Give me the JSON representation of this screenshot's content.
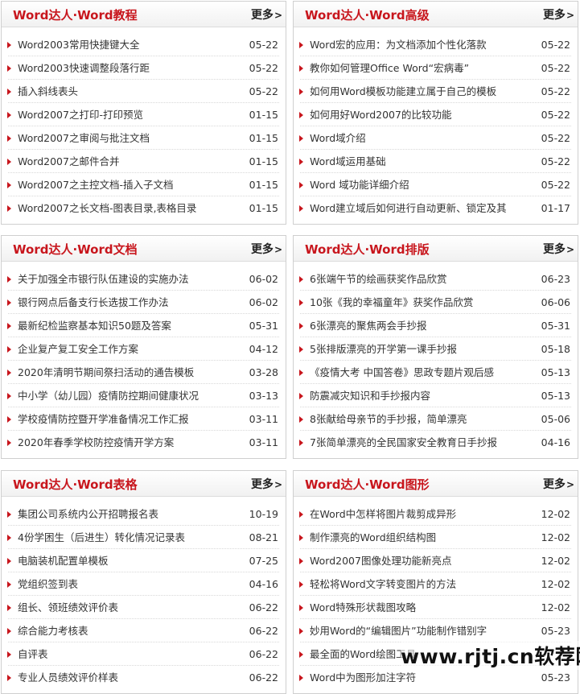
{
  "panels": [
    {
      "title": "Word达人·Word教程",
      "more": "更多",
      "items": [
        {
          "text": "Word2003常用快捷键大全",
          "date": "05-22"
        },
        {
          "text": "Word2003快速调整段落行距",
          "date": "05-22"
        },
        {
          "text": "插入斜线表头",
          "date": "05-22"
        },
        {
          "text": "Word2007之打印-打印预览",
          "date": "01-15"
        },
        {
          "text": "Word2007之审阅与批注文档",
          "date": "01-15"
        },
        {
          "text": "Word2007之邮件合并",
          "date": "01-15"
        },
        {
          "text": "Word2007之主控文档-插入子文档",
          "date": "01-15"
        },
        {
          "text": "Word2007之长文档-图表目录,表格目录",
          "date": "01-15"
        }
      ]
    },
    {
      "title": "Word达人·Word高级",
      "more": "更多",
      "items": [
        {
          "text": "Word宏的应用：为文档添加个性化落款",
          "date": "05-22"
        },
        {
          "text": "教你如何管理Office Word“宏病毒”",
          "date": "05-22"
        },
        {
          "text": "如何用Word模板功能建立属于自己的模板",
          "date": "05-22"
        },
        {
          "text": "如何用好Word2007的比较功能",
          "date": "05-22"
        },
        {
          "text": "Word域介绍",
          "date": "05-22"
        },
        {
          "text": "Word域运用基础",
          "date": "05-22"
        },
        {
          "text": "Word 域功能详细介绍",
          "date": "05-22"
        },
        {
          "text": "Word建立域后如何进行自动更新、锁定及其",
          "date": "01-17"
        }
      ]
    },
    {
      "title": "Word达人·Word文档",
      "more": "更多",
      "items": [
        {
          "text": "关于加强全市银行队伍建设的实施办法",
          "date": "06-02"
        },
        {
          "text": "银行网点后备支行长选拔工作办法",
          "date": "06-02"
        },
        {
          "text": "最新纪检监察基本知识50题及答案",
          "date": "05-31"
        },
        {
          "text": "企业复产复工安全工作方案",
          "date": "04-12"
        },
        {
          "text": "2020年清明节期间祭扫活动的通告模板",
          "date": "03-28"
        },
        {
          "text": "中小学（幼儿园）疫情防控期间健康状况",
          "date": "03-13"
        },
        {
          "text": "学校疫情防控暨开学准备情况工作汇报",
          "date": "03-11"
        },
        {
          "text": "2020年春季学校防控疫情开学方案",
          "date": "03-11"
        }
      ]
    },
    {
      "title": "Word达人·Word排版",
      "more": "更多",
      "items": [
        {
          "text": "6张端午节的绘画获奖作品欣赏",
          "date": "06-23"
        },
        {
          "text": "10张《我的幸福童年》获奖作品欣赏",
          "date": "06-06"
        },
        {
          "text": "6张漂亮的聚焦两会手抄报",
          "date": "05-31"
        },
        {
          "text": "5张排版漂亮的开学第一课手抄报",
          "date": "05-18"
        },
        {
          "text": "《疫情大考 中国答卷》思政专题片观后感",
          "date": "05-13"
        },
        {
          "text": "防震减灾知识和手抄报内容",
          "date": "05-13"
        },
        {
          "text": "8张献给母亲节的手抄报，简单漂亮",
          "date": "05-06"
        },
        {
          "text": "7张简单漂亮的全民国家安全教育日手抄报",
          "date": "04-16"
        }
      ]
    },
    {
      "title": "Word达人·Word表格",
      "more": "更多",
      "items": [
        {
          "text": "集团公司系统内公开招聘报名表",
          "date": "10-19"
        },
        {
          "text": "4份学困生（后进生）转化情况记录表",
          "date": "08-21"
        },
        {
          "text": "电脑装机配置单模板",
          "date": "07-25"
        },
        {
          "text": "党组织签到表",
          "date": "04-16"
        },
        {
          "text": "组长、领班绩效评价表",
          "date": "06-22"
        },
        {
          "text": "综合能力考核表",
          "date": "06-22"
        },
        {
          "text": "自评表",
          "date": "06-22"
        },
        {
          "text": "专业人员绩效评价样表",
          "date": "06-22"
        }
      ]
    },
    {
      "title": "Word达人·Word图形",
      "more": "更多",
      "items": [
        {
          "text": "在Word中怎样将图片裁剪成异形",
          "date": "12-02"
        },
        {
          "text": "制作漂亮的Word组织结构图",
          "date": "12-02"
        },
        {
          "text": "Word2007图像处理功能新亮点",
          "date": "12-02"
        },
        {
          "text": "轻松将Word文字转变图片的方法",
          "date": "12-02"
        },
        {
          "text": "Word特殊形状裁图攻略",
          "date": "12-02"
        },
        {
          "text": "妙用Word的“编辑图片”功能制作错别字",
          "date": "05-23"
        },
        {
          "text": "最全面的Word绘图工具",
          "date": ""
        },
        {
          "text": "Word中为图形加注字符",
          "date": "05-23"
        }
      ]
    }
  ],
  "watermark": "www.rjtj.cn软荐网",
  "colors": {
    "accent": "#c8161d",
    "text": "#333333",
    "border": "#cfcfcf"
  }
}
